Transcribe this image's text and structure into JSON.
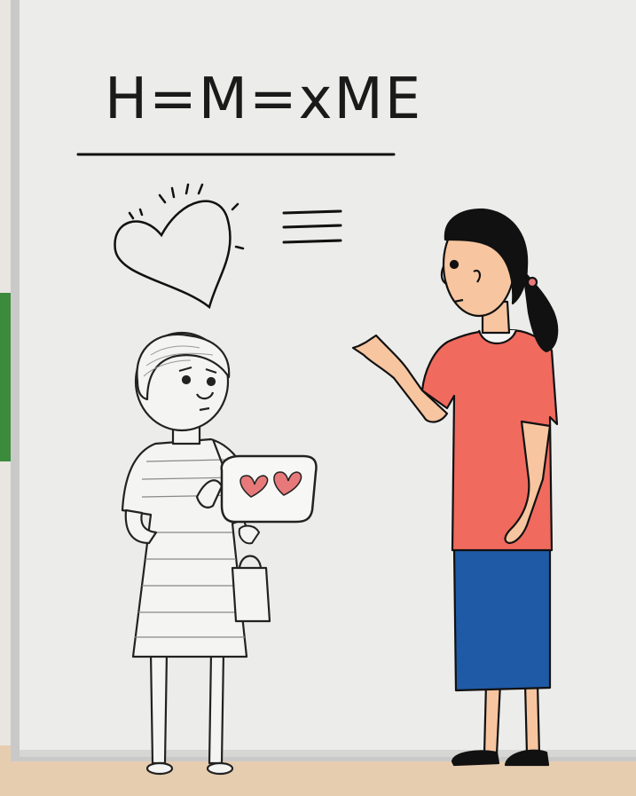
{
  "whiteboard": {
    "heading": "H=M=xME"
  },
  "colors": {
    "board": "#ececea",
    "frame": "#c9c9c9",
    "floor": "#e7cdb0",
    "wall_green": "#3c8a3c",
    "shirt": "#f06a5e",
    "skirt": "#1f5aa6",
    "skin": "#f7c59f",
    "hair": "#111111",
    "heart_pink": "#e8797a"
  },
  "icons": {
    "drawn_heart": "heart-doodle-icon",
    "equals_lines": "triple-bar-icon",
    "card_hearts": "heart-icon"
  }
}
